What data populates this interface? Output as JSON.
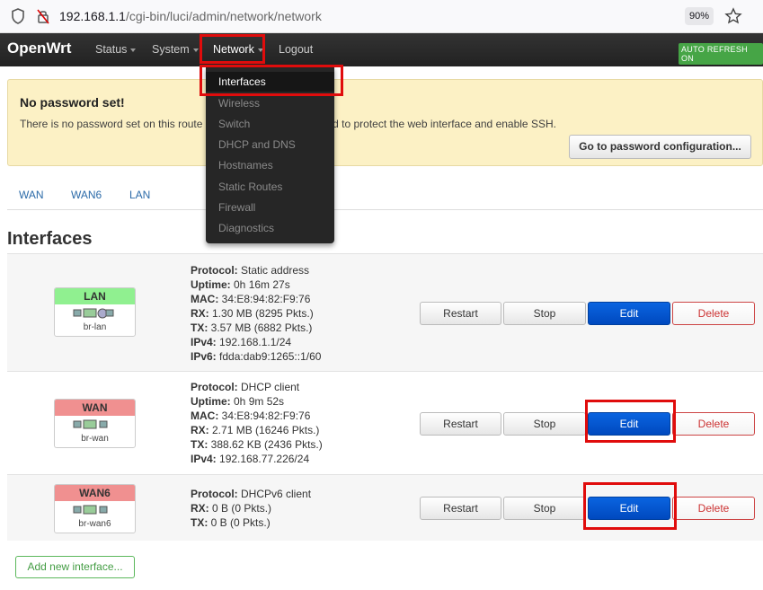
{
  "browser": {
    "url_host": "192.168.1.1",
    "url_path": "/cgi-bin/luci/admin/network/network",
    "zoom": "90%"
  },
  "navbar": {
    "brand": "OpenWrt",
    "items": [
      {
        "label": "Status"
      },
      {
        "label": "System"
      },
      {
        "label": "Network"
      },
      {
        "label": "Logout"
      }
    ],
    "autorefresh": "AUTO REFRESH ON"
  },
  "dropdown": {
    "items": [
      {
        "label": "Interfaces"
      },
      {
        "label": "Wireless"
      },
      {
        "label": "Switch"
      },
      {
        "label": "DHCP and DNS"
      },
      {
        "label": "Hostnames"
      },
      {
        "label": "Static Routes"
      },
      {
        "label": "Firewall"
      },
      {
        "label": "Diagnostics"
      }
    ]
  },
  "alert": {
    "title": "No password set!",
    "text_before": "There is no password set on this route",
    "text_after": "password to protect the web interface and enable SSH.",
    "button": "Go to password configuration..."
  },
  "tabs": [
    "WAN",
    "WAN6",
    "LAN"
  ],
  "section_title": "Interfaces",
  "interfaces": [
    {
      "name": "LAN",
      "device": "br-lan",
      "info": [
        {
          "k": "Protocol:",
          "v": " Static address"
        },
        {
          "k": "Uptime:",
          "v": " 0h 16m 27s"
        },
        {
          "k": "MAC:",
          "v": " 34:E8:94:82:F9:76"
        },
        {
          "k": "RX:",
          "v": " 1.30 MB (8295 Pkts.)"
        },
        {
          "k": "TX:",
          "v": " 3.57 MB (6882 Pkts.)"
        },
        {
          "k": "IPv4:",
          "v": " 192.168.1.1/24"
        },
        {
          "k": "IPv6:",
          "v": " fdda:dab9:1265::1/60"
        }
      ]
    },
    {
      "name": "WAN",
      "device": "br-wan",
      "info": [
        {
          "k": "Protocol:",
          "v": " DHCP client"
        },
        {
          "k": "Uptime:",
          "v": " 0h 9m 52s"
        },
        {
          "k": "MAC:",
          "v": " 34:E8:94:82:F9:76"
        },
        {
          "k": "RX:",
          "v": " 2.71 MB (16246 Pkts.)"
        },
        {
          "k": "TX:",
          "v": " 388.62 KB (2436 Pkts.)"
        },
        {
          "k": "IPv4:",
          "v": " 192.168.77.226/24"
        }
      ]
    },
    {
      "name": "WAN6",
      "device": "br-wan6",
      "info": [
        {
          "k": "Protocol:",
          "v": " DHCPv6 client"
        },
        {
          "k": "RX:",
          "v": " 0 B (0 Pkts.)"
        },
        {
          "k": "TX:",
          "v": " 0 B (0 Pkts.)"
        }
      ]
    }
  ],
  "buttons": {
    "restart": "Restart",
    "stop": "Stop",
    "edit": "Edit",
    "delete": "Delete"
  },
  "add_interface": "Add new interface...",
  "colors": {
    "highlight": "#e00c0c",
    "edit_blue": "#0049bf",
    "lan_green": "#90f090",
    "wan_red": "#f09090"
  }
}
